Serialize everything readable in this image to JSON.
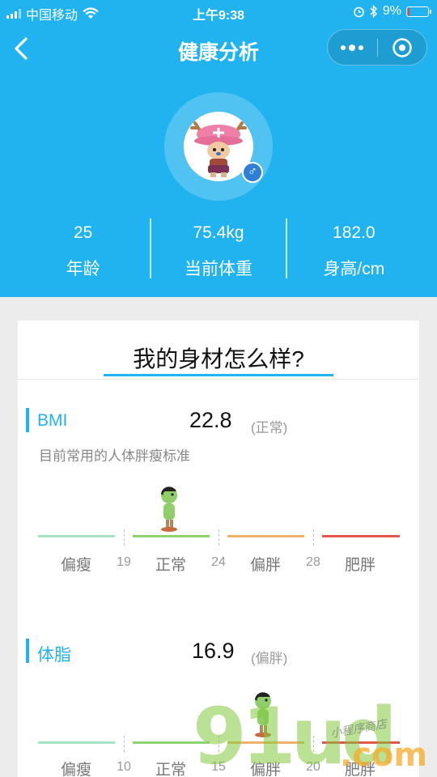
{
  "status_bar": {
    "carrier": "中国移动",
    "time": "上午9:38",
    "battery": "9%",
    "battery_level": 0.09
  },
  "nav": {
    "title": "健康分析"
  },
  "profile": {
    "gender_symbol": "♂",
    "stats": [
      {
        "value": "25",
        "label": "年龄"
      },
      {
        "value": "75.4kg",
        "label": "当前体重"
      },
      {
        "value": "182.0",
        "label": "身高/cm"
      }
    ]
  },
  "card": {
    "title": "我的身材怎么样?"
  },
  "bmi": {
    "label": "BMI",
    "value": "22.8",
    "status": "(正常)",
    "description": "目前常用的人体胖瘦标准",
    "categories": [
      "偏瘦",
      "正常",
      "偏胖",
      "肥胖"
    ],
    "thresholds": [
      "19",
      "24",
      "28"
    ]
  },
  "body_fat": {
    "label": "体脂",
    "value": "16.9",
    "status": "(偏胖)",
    "categories": [
      "偏瘦",
      "正常",
      "偏胖",
      "肥胖"
    ],
    "thresholds": [
      "10",
      "15",
      "20"
    ]
  },
  "colors": {
    "header_blue": "#21b3f0",
    "thin": "#a8e2c4",
    "normal": "#8fd36f",
    "overweight": "#f0b26a",
    "obese": "#e4574c"
  },
  "watermark": {
    "big": "91ud",
    "com": ".com",
    "small": "小程序商店"
  }
}
